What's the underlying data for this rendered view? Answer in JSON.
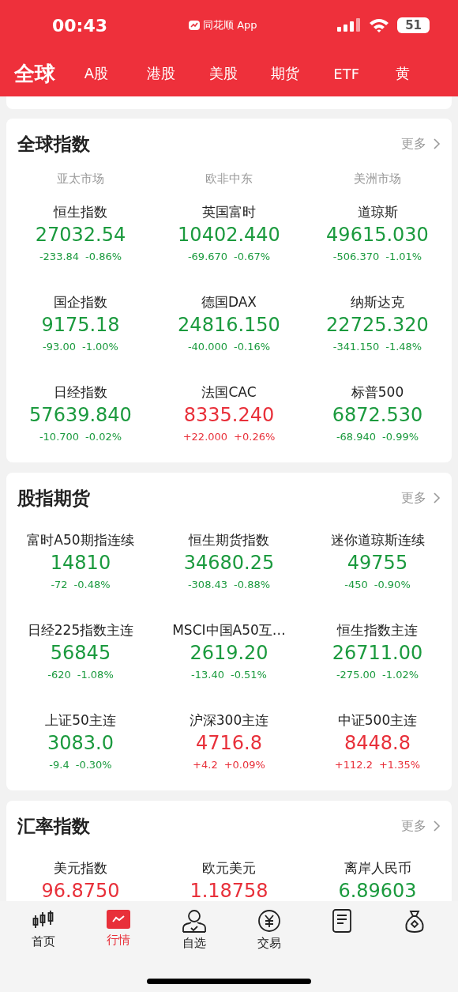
{
  "status_bar": {
    "time": "00:43",
    "app_label": "同花顺 App",
    "battery": "51"
  },
  "tabs": [
    {
      "label": "全球",
      "selected": true
    },
    {
      "label": "A股",
      "selected": false
    },
    {
      "label": "港股",
      "selected": false
    },
    {
      "label": "美股",
      "selected": false
    },
    {
      "label": "期货",
      "selected": false
    },
    {
      "label": "ETF",
      "selected": false
    },
    {
      "label": "黄",
      "selected": false
    }
  ],
  "sections": [
    {
      "title": "全球指数",
      "more": "更多",
      "column_headers": [
        "亚太市场",
        "欧非中东",
        "美洲市场"
      ],
      "items": [
        {
          "name": "恒生指数",
          "price": "27032.54",
          "change": "-233.84",
          "change_pct": "-0.86%",
          "rising": false
        },
        {
          "name": "英国富时",
          "price": "10402.440",
          "change": "-69.670",
          "change_pct": "-0.67%",
          "rising": false
        },
        {
          "name": "道琼斯",
          "price": "49615.030",
          "change": "-506.370",
          "change_pct": "-1.01%",
          "rising": false
        },
        {
          "name": "国企指数",
          "price": "9175.18",
          "change": "-93.00",
          "change_pct": "-1.00%",
          "rising": false
        },
        {
          "name": "德国DAX",
          "price": "24816.150",
          "change": "-40.000",
          "change_pct": "-0.16%",
          "rising": false
        },
        {
          "name": "纳斯达克",
          "price": "22725.320",
          "change": "-341.150",
          "change_pct": "-1.48%",
          "rising": false
        },
        {
          "name": "日经指数",
          "price": "57639.840",
          "change": "-10.700",
          "change_pct": "-0.02%",
          "rising": false
        },
        {
          "name": "法国CAC",
          "price": "8335.240",
          "change": "+22.000",
          "change_pct": "+0.26%",
          "rising": true
        },
        {
          "name": "标普500",
          "price": "6872.530",
          "change": "-68.940",
          "change_pct": "-0.99%",
          "rising": false
        }
      ]
    },
    {
      "title": "股指期货",
      "more": "更多",
      "items": [
        {
          "name": "富时A50期指连续",
          "price": "14810",
          "change": "-72",
          "change_pct": "-0.48%",
          "rising": false
        },
        {
          "name": "恒生期货指数",
          "price": "34680.25",
          "change": "-308.43",
          "change_pct": "-0.88%",
          "rising": false
        },
        {
          "name": "迷你道琼斯连续",
          "price": "49755",
          "change": "-450",
          "change_pct": "-0.90%",
          "rising": false
        },
        {
          "name": "日经225指数主连",
          "price": "56845",
          "change": "-620",
          "change_pct": "-1.08%",
          "rising": false
        },
        {
          "name": "MSCI中国A50互…",
          "price": "2619.20",
          "change": "-13.40",
          "change_pct": "-0.51%",
          "rising": false
        },
        {
          "name": "恒生指数主连",
          "price": "26711.00",
          "change": "-275.00",
          "change_pct": "-1.02%",
          "rising": false
        },
        {
          "name": "上证50主连",
          "price": "3083.0",
          "change": "-9.4",
          "change_pct": "-0.30%",
          "rising": false
        },
        {
          "name": "沪深300主连",
          "price": "4716.8",
          "change": "+4.2",
          "change_pct": "+0.09%",
          "rising": true
        },
        {
          "name": "中证500主连",
          "price": "8448.8",
          "change": "+112.2",
          "change_pct": "+1.35%",
          "rising": true
        }
      ]
    },
    {
      "title": "汇率指数",
      "more": "更多",
      "items": [
        {
          "name": "美元指数",
          "price": "96.8750",
          "rising": true
        },
        {
          "name": "欧元美元",
          "price": "1.18758",
          "rising": true
        },
        {
          "name": "离岸人民币",
          "price": "6.89603",
          "rising": false
        }
      ]
    }
  ],
  "bottom_nav": [
    {
      "kind": "candles",
      "label": "首页",
      "selected": false
    },
    {
      "kind": "trend",
      "label": "行情",
      "selected": true
    },
    {
      "kind": "person",
      "label": "自选",
      "selected": false
    },
    {
      "kind": "yen",
      "label": "交易",
      "selected": false
    },
    {
      "kind": "document",
      "selected": false
    },
    {
      "kind": "bag",
      "selected": false
    }
  ]
}
